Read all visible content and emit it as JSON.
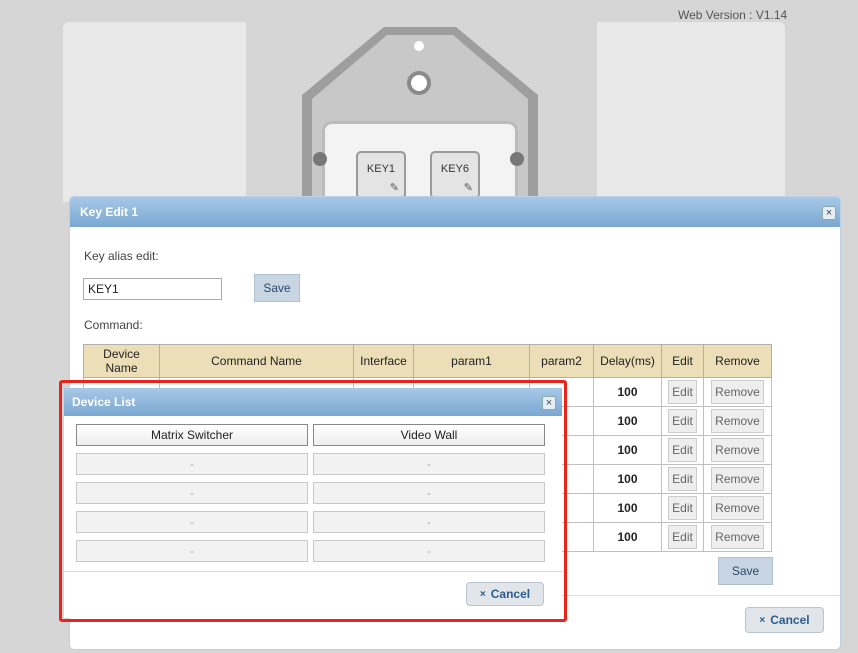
{
  "version_text": "Web Version : V1.14",
  "plate": {
    "key_left": "KEY1",
    "key_right": "KEY6",
    "edit_glyph": "✎"
  },
  "key_edit": {
    "title": "Key Edit 1",
    "close_glyph": "×",
    "alias_label": "Key alias edit:",
    "alias_value": "KEY1",
    "save_label": "Save",
    "command_label": "Command:",
    "columns": [
      "Device Name",
      "Command Name",
      "Interface",
      "param1",
      "param2",
      "Delay(ms)",
      "Edit",
      "Remove"
    ],
    "rows": [
      {
        "delay": "100",
        "edit": "Edit",
        "remove": "Remove"
      },
      {
        "delay": "100",
        "edit": "Edit",
        "remove": "Remove"
      },
      {
        "delay": "100",
        "edit": "Edit",
        "remove": "Remove"
      },
      {
        "delay": "100",
        "edit": "Edit",
        "remove": "Remove"
      },
      {
        "delay": "100",
        "edit": "Edit",
        "remove": "Remove"
      },
      {
        "delay": "100",
        "edit": "Edit",
        "remove": "Remove"
      }
    ],
    "table_save_label": "Save",
    "cancel_label": "Cancel",
    "cancel_glyph": "×"
  },
  "device_list": {
    "title": "Device List",
    "close_glyph": "×",
    "devices": [
      "Matrix Switcher",
      "Video Wall",
      "-",
      "-",
      "-",
      "-",
      "-",
      "-",
      "-",
      "-"
    ],
    "cancel_label": "Cancel",
    "cancel_glyph": "×"
  }
}
